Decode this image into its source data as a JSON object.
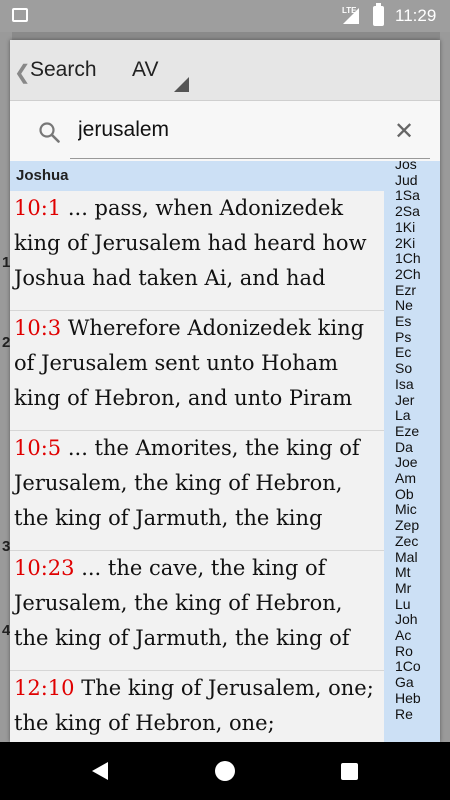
{
  "status_bar": {
    "network": "LTE",
    "time": "11:29"
  },
  "background": {
    "verse_numbers": [
      "1",
      "2",
      "3",
      "4"
    ]
  },
  "header": {
    "back_label": "Search",
    "version": "AV"
  },
  "search": {
    "query": "jerusalem"
  },
  "results": {
    "group": "Joshua",
    "items": [
      {
        "ref": "10:1",
        "text": " ... pass, when Adonizedek king of Jerusalem had heard how Joshua had taken Ai, and had"
      },
      {
        "ref": "10:3",
        "text": " Wherefore Adonizedek king of Jerusalem sent unto Hoham king of Hebron, and unto Piram"
      },
      {
        "ref": "10:5",
        "text": " ... the Amorites, the king of Jerusalem, the king of Hebron, the king of Jarmuth, the king"
      },
      {
        "ref": "10:23",
        "text": " ... the cave, the king of Jerusalem, the king of Hebron, the king of Jarmuth, the king of"
      },
      {
        "ref": "12:10",
        "text": " The king of Jerusalem, one; the king of Hebron, one;"
      }
    ]
  },
  "book_index": [
    "Jos",
    "Jud",
    "1Sa",
    "2Sa",
    "1Ki",
    "2Ki",
    "1Ch",
    "2Ch",
    "Ezr",
    "Ne",
    "Es",
    "Ps",
    "Ec",
    "So",
    "Isa",
    "Jer",
    "La",
    "Eze",
    "Da",
    "Joe",
    "Am",
    "Ob",
    "Mic",
    "Zep",
    "Zec",
    "Mal",
    "Mt",
    "Mr",
    "Lu",
    "Joh",
    "Ac",
    "Ro",
    "1Co",
    "Ga",
    "Heb",
    "Re"
  ],
  "colors": {
    "accent": "#cce0f5",
    "reference": "#e00000"
  }
}
